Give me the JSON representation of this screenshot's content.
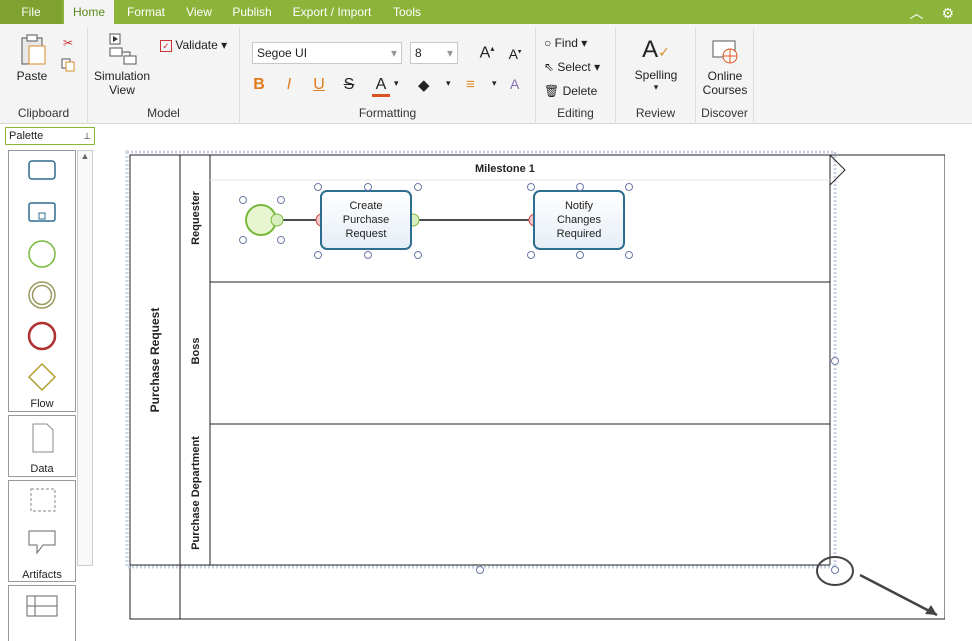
{
  "tabs": [
    {
      "label": "File"
    },
    {
      "label": "Home"
    },
    {
      "label": "Format"
    },
    {
      "label": "View"
    },
    {
      "label": "Publish"
    },
    {
      "label": "Export / Import"
    },
    {
      "label": "Tools"
    }
  ],
  "ribbon": {
    "clipboard": {
      "paste": "Paste",
      "label": "Clipboard"
    },
    "model": {
      "simulation": "Simulation View",
      "validate": "Validate",
      "label": "Model"
    },
    "formatting": {
      "font": "Segoe UI",
      "size": "8",
      "label": "Formatting",
      "bold": "B",
      "italic": "I",
      "underline": "U",
      "strike": "S",
      "fontcolor": "A"
    },
    "editing": {
      "find": "Find",
      "select": "Select",
      "delete": "Delete",
      "label": "Editing"
    },
    "review": {
      "spelling": "Spelling",
      "label": "Review"
    },
    "discover": {
      "courses": "Online Courses",
      "label": "Discover"
    }
  },
  "palette": {
    "header": "Palette",
    "flow": "Flow",
    "data": "Data",
    "artifacts": "Artifacts"
  },
  "diagram": {
    "pool": "Purchase Request",
    "milestone": "Milestone 1",
    "lanes": [
      {
        "label": "Requester"
      },
      {
        "label": "Boss"
      },
      {
        "label": "Purchase Department"
      }
    ],
    "tasks": [
      {
        "label": "Create Purchase Request"
      },
      {
        "label": "Notify Changes Required"
      }
    ]
  },
  "colors": {
    "accent": "#8cb33a",
    "task_border": "#2d6d8f",
    "start_event": "#78b93b",
    "end_event": "#b03030"
  }
}
